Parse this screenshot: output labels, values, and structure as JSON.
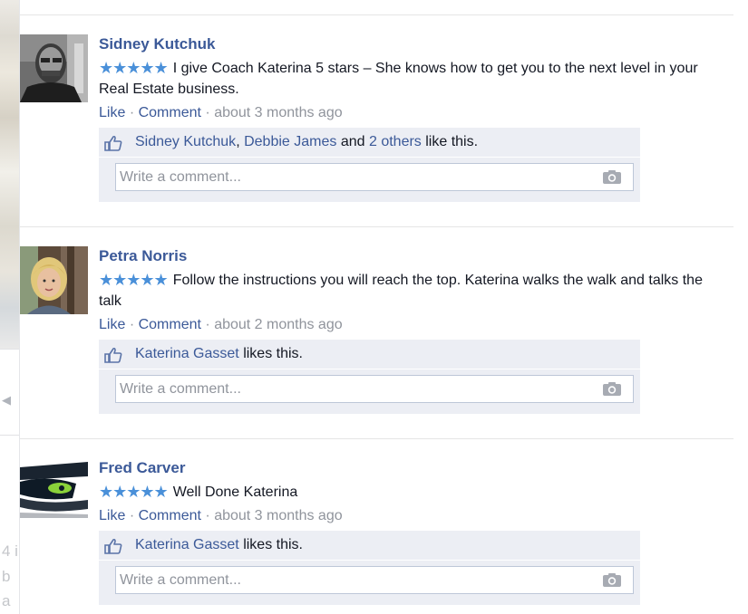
{
  "colors": {
    "link": "#3b5998",
    "stars": "#4a90d9",
    "meta": "#90949c",
    "ufi_background": "#eceef4",
    "input_border": "#bdc7d8"
  },
  "background_fragment": {
    "lines": [
      "4 i",
      "b",
      "a"
    ]
  },
  "posts": [
    {
      "author": "Sidney Kutchuk",
      "avatar_icon": "user-photo-icon",
      "stars": "★★★★★",
      "text": "I give Coach Katerina 5 stars – She knows how to get you to the next level in your Real Estate business.",
      "like_label": "Like",
      "comment_label": "Comment",
      "separator": "·",
      "time": "about 3 months ago",
      "likes": {
        "name1": "Sidney Kutchuk",
        "comma": ",",
        "name2": "Debbie James",
        "and": "and",
        "others": "2 others",
        "suffix": "like this."
      },
      "comment_placeholder": "Write a comment..."
    },
    {
      "author": "Petra Norris",
      "avatar_icon": "user-photo-icon",
      "stars": "★★★★★",
      "text": "Follow the instructions you will reach the top. Katerina walks the walk and talks the talk",
      "like_label": "Like",
      "comment_label": "Comment",
      "separator": "·",
      "time": "about 2 months ago",
      "likes": {
        "name1": "Katerina Gasset",
        "suffix": "likes this."
      },
      "comment_placeholder": "Write a comment..."
    },
    {
      "author": "Fred Carver",
      "avatar_icon": "user-photo-icon",
      "stars": "★★★★★",
      "text": "Well Done Katerina",
      "like_label": "Like",
      "comment_label": "Comment",
      "separator": "·",
      "time": "about 3 months ago",
      "likes": {
        "name1": "Katerina Gasset",
        "suffix": "likes this."
      },
      "comment_placeholder": "Write a comment..."
    }
  ]
}
